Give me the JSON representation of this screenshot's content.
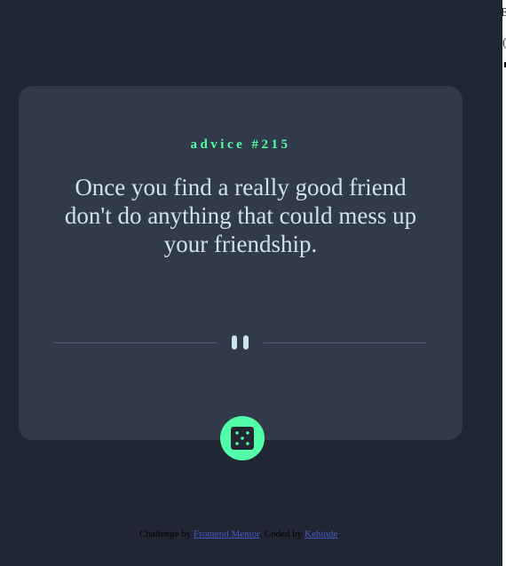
{
  "card": {
    "advice_label": "advice #215",
    "advice_text": "Once you find a really good friend don't do anything that could mess up your friendship."
  },
  "dice_button": {
    "icon": "dice-icon"
  },
  "divider": {
    "icon": "pause-icon"
  },
  "attribution": {
    "prefix": "Challenge by",
    "frontend_mentor_link": "Frontend Mentor",
    "middle": ". Coded by",
    "author_link": "Kehinde",
    "suffix": "."
  },
  "colors": {
    "background": "#202632",
    "card": "#313a49",
    "accent": "#52ffa8",
    "text": "#cee3e9",
    "divider": "#4f5d74"
  }
}
